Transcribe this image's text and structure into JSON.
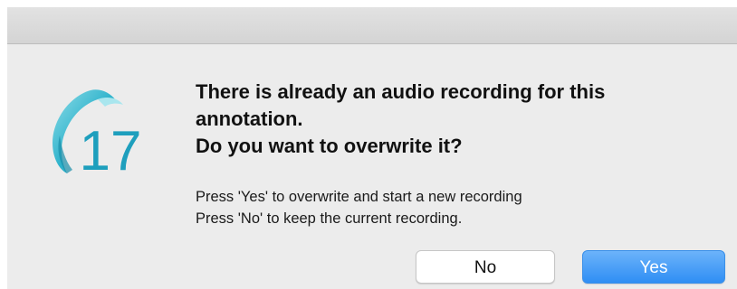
{
  "dialog": {
    "icon": {
      "name": "app-icon",
      "label": "17",
      "color": "#2ab0cc"
    },
    "message": {
      "line1": "There is already an audio recording for this",
      "line2": "annotation.",
      "line3": "Do you want to overwrite it?"
    },
    "informative": {
      "line1": "Press 'Yes' to overwrite and start a new recording",
      "line2": "Press 'No' to keep the current recording."
    },
    "buttons": {
      "no_label": "No",
      "yes_label": "Yes"
    },
    "colors": {
      "default_button": "#3d95f5",
      "titlebar": "#dbdbdb",
      "background": "#ececec"
    }
  }
}
